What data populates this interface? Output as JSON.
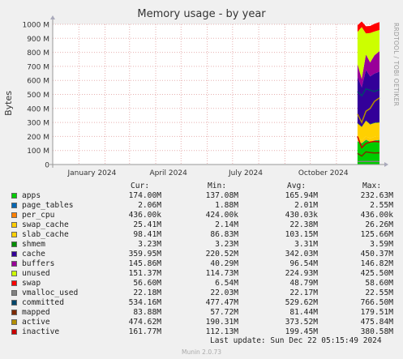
{
  "title": "Memory usage - by year",
  "side_label": "RRDTOOL / TOBI OETIKER",
  "ylabel": "Bytes",
  "legend_headers": [
    "Cur:",
    "Min:",
    "Avg:",
    "Max:"
  ],
  "footer": "Last update: Sun Dec 22 05:15:49 2024",
  "version": "Munin 2.0.73",
  "chart_data": {
    "type": "area",
    "title": "Memory usage - by year",
    "ylabel": "Bytes",
    "ylim": [
      0,
      1000
    ],
    "y_unit": "M",
    "yticks": [
      "0",
      "100 M",
      "200 M",
      "300 M",
      "400 M",
      "500 M",
      "600 M",
      "700 M",
      "800 M",
      "900 M",
      "1000 M"
    ],
    "xticks": [
      "January 2024",
      "April 2024",
      "July 2024",
      "October 2024"
    ],
    "x_range": [
      "2023-12",
      "2024-12-22"
    ],
    "x": [
      "2024-11-26",
      "2024-12-01",
      "2024-12-06",
      "2024-12-11",
      "2024-12-16",
      "2024-12-22"
    ],
    "series": [
      {
        "name": "apps",
        "color": "#00cc00",
        "values": [
          165,
          150,
          175,
          160,
          170,
          174
        ]
      },
      {
        "name": "page_tables",
        "color": "#0066b3",
        "values": [
          2,
          2,
          2,
          2,
          2,
          2
        ]
      },
      {
        "name": "per_cpu",
        "color": "#ff8000",
        "values": [
          0.4,
          0.4,
          0.4,
          0.4,
          0.4,
          0.4
        ]
      },
      {
        "name": "swap_cache",
        "color": "#ffcc00",
        "values": [
          22,
          20,
          24,
          23,
          25,
          25
        ]
      },
      {
        "name": "slab_cache",
        "color": "#ffd000",
        "values": [
          103,
          95,
          110,
          100,
          98,
          98
        ]
      },
      {
        "name": "shmem",
        "color": "#008f00",
        "values": [
          3,
          3,
          3,
          3,
          3,
          3
        ]
      },
      {
        "name": "cache",
        "color": "#330099",
        "values": [
          330,
          280,
          360,
          340,
          350,
          360
        ]
      },
      {
        "name": "buffers",
        "color": "#990099",
        "values": [
          90,
          60,
          110,
          100,
          130,
          146
        ]
      },
      {
        "name": "unused",
        "color": "#ccff00",
        "values": [
          230,
          370,
          150,
          210,
          170,
          151
        ]
      },
      {
        "name": "swap",
        "color": "#ff0000",
        "values": [
          48,
          40,
          52,
          50,
          55,
          57
        ]
      },
      {
        "name": "vmalloc_used",
        "color": "#808080",
        "values": [
          22,
          22,
          22,
          22,
          22,
          22
        ]
      },
      {
        "name": "committed",
        "color": "#00476b",
        "values": [
          520,
          490,
          540,
          530,
          520,
          534
        ]
      },
      {
        "name": "mapped",
        "color": "#7e2a00",
        "values": [
          80,
          60,
          90,
          85,
          82,
          84
        ]
      },
      {
        "name": "active",
        "color": "#b38e00",
        "values": [
          360,
          300,
          380,
          400,
          450,
          475
        ]
      },
      {
        "name": "inactive",
        "color": "#cc0000",
        "values": [
          200,
          120,
          150,
          160,
          165,
          162
        ]
      }
    ],
    "legend": [
      {
        "name": "apps",
        "cur": "174.00M",
        "min": "137.08M",
        "avg": "165.94M",
        "max": "232.63M"
      },
      {
        "name": "page_tables",
        "cur": "2.06M",
        "min": "1.88M",
        "avg": "2.01M",
        "max": "2.55M"
      },
      {
        "name": "per_cpu",
        "cur": "436.00k",
        "min": "424.00k",
        "avg": "430.03k",
        "max": "436.00k"
      },
      {
        "name": "swap_cache",
        "cur": "25.41M",
        "min": "2.14M",
        "avg": "22.38M",
        "max": "26.26M"
      },
      {
        "name": "slab_cache",
        "cur": "98.41M",
        "min": "86.83M",
        "avg": "103.15M",
        "max": "125.66M"
      },
      {
        "name": "shmem",
        "cur": "3.23M",
        "min": "3.23M",
        "avg": "3.31M",
        "max": "3.59M"
      },
      {
        "name": "cache",
        "cur": "359.95M",
        "min": "220.52M",
        "avg": "342.03M",
        "max": "450.37M"
      },
      {
        "name": "buffers",
        "cur": "145.86M",
        "min": "40.29M",
        "avg": "96.54M",
        "max": "146.82M"
      },
      {
        "name": "unused",
        "cur": "151.37M",
        "min": "114.73M",
        "avg": "224.93M",
        "max": "425.50M"
      },
      {
        "name": "swap",
        "cur": "56.60M",
        "min": "6.54M",
        "avg": "48.79M",
        "max": "58.60M"
      },
      {
        "name": "vmalloc_used",
        "cur": "22.18M",
        "min": "22.03M",
        "avg": "22.17M",
        "max": "22.55M"
      },
      {
        "name": "committed",
        "cur": "534.16M",
        "min": "477.47M",
        "avg": "529.62M",
        "max": "766.50M"
      },
      {
        "name": "mapped",
        "cur": "83.88M",
        "min": "57.72M",
        "avg": "81.44M",
        "max": "179.51M"
      },
      {
        "name": "active",
        "cur": "474.62M",
        "min": "190.31M",
        "avg": "373.52M",
        "max": "475.84M"
      },
      {
        "name": "inactive",
        "cur": "161.77M",
        "min": "112.13M",
        "avg": "199.45M",
        "max": "380.58M"
      }
    ]
  }
}
